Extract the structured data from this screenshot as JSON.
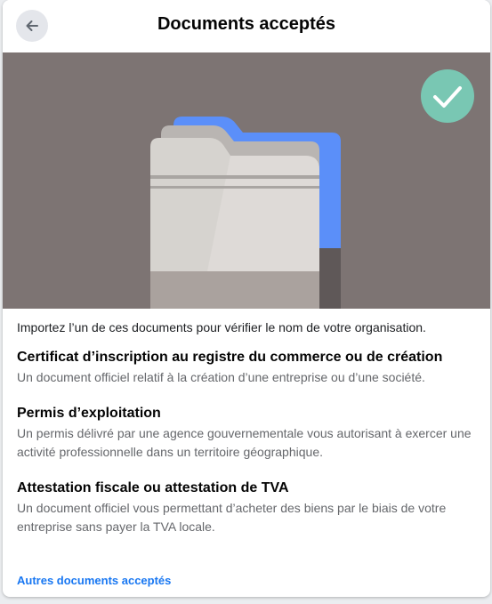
{
  "header": {
    "title": "Documents acceptés"
  },
  "hero": {
    "icon": "folder-illustration",
    "badge_icon": "checkmark-icon",
    "colors": {
      "background": "#7d7473",
      "badge": "#79c7b3",
      "folder_back": "#5b8ff9"
    }
  },
  "intro": "Importez l’un de ces documents pour vérifier le nom de votre organisation.",
  "documents": [
    {
      "title": "Certificat d’inscription au registre du commerce ou de création",
      "description": "Un document officiel relatif à la création d’une entreprise ou d’une société."
    },
    {
      "title": "Permis d’exploitation",
      "description": "Un permis délivré par une agence gouvernementale vous autorisant à exercer une activité professionnelle dans un territoire géographique."
    },
    {
      "title": "Attestation fiscale ou attestation de TVA",
      "description": "Un document officiel vous permettant d’acheter des biens par le biais de votre entreprise sans payer la TVA locale."
    }
  ],
  "more_link": "Autres documents acceptés"
}
